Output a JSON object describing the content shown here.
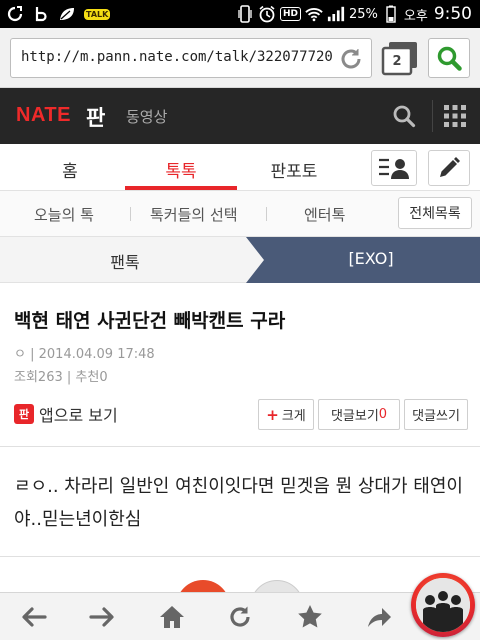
{
  "status_bar": {
    "kakao_badge": "TALK",
    "hd": "HD",
    "battery": "25%",
    "ampm": "오후",
    "time": "9:50"
  },
  "browser": {
    "url": "http://m.pann.nate.com/talk/322077720",
    "tab_count": "2"
  },
  "header": {
    "logo": "NATE",
    "pann": "판",
    "video": "동영상"
  },
  "main_tabs": [
    "홈",
    "톡톡",
    "판포토"
  ],
  "sub_tabs": [
    "오늘의 톡",
    "톡커들의 선택",
    "엔터톡"
  ],
  "all_list_label": "전체목록",
  "breadcrumb": {
    "section": "팬톡",
    "category": "[EXO]"
  },
  "article": {
    "title": "백현 태연 사귄단건 빼박캔트 구라",
    "author_mark": "ㅇ",
    "date": "2014.04.09 17:48",
    "views_label": "조회",
    "views": "263",
    "recommend_label": "추천",
    "recommend": "0",
    "app_icon": "판",
    "app_view_label": "앱으로 보기",
    "large_label": "크게",
    "comments_view_label": "댓글보기",
    "comments_count": "0",
    "comment_write_label": "댓글쓰기",
    "body": "ㄹㅇ.. 차라리 일반인 여친이잇다면 믿겟음 뭔 상대가 태연이야..믿는년이한심"
  },
  "colors": {
    "accent_red": "#e8262a",
    "header_dark": "#262626",
    "category_blue": "#4a5a78",
    "search_green": "#2f9a2f"
  },
  "icons": [
    "back-icon",
    "forward-icon",
    "home-icon",
    "reload-icon",
    "star-icon",
    "share-icon",
    "search-icon",
    "grid-icon",
    "user-list-icon",
    "pencil-icon",
    "tabs-icon"
  ]
}
